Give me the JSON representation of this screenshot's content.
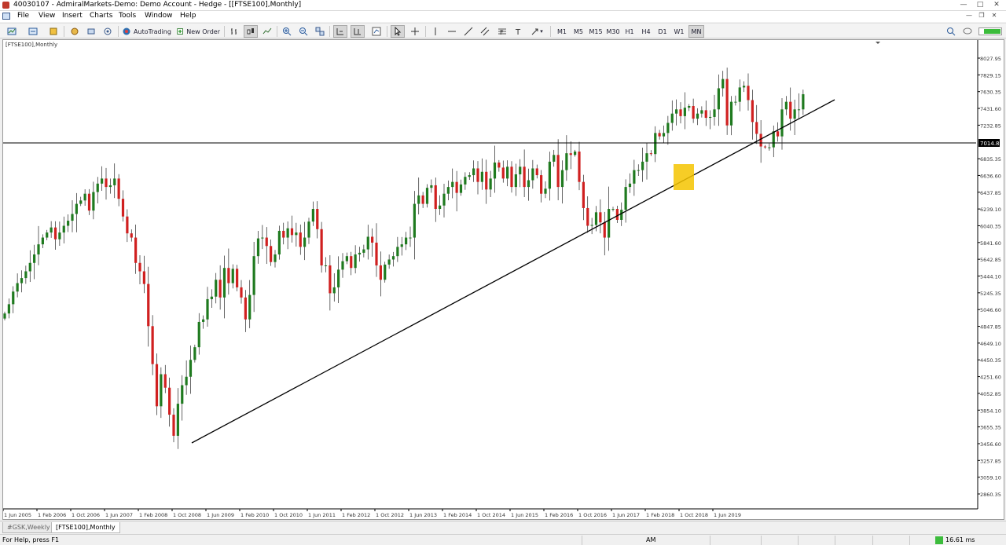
{
  "window": {
    "title": "40030107 - AdmiralMarkets-Demo: Demo Account - Hedge - [[FTSE100],Monthly]"
  },
  "menu": [
    "File",
    "View",
    "Insert",
    "Charts",
    "Tools",
    "Window",
    "Help"
  ],
  "toolbar": {
    "autotrading_label": "AutoTrading",
    "new_order_label": "New Order",
    "timeframes": [
      "M1",
      "M5",
      "M15",
      "M30",
      "H1",
      "H4",
      "D1",
      "W1",
      "MN"
    ],
    "active_timeframe": "MN"
  },
  "chart": {
    "label": "[FTSE100],Monthly",
    "price_labels": [
      "8027.95",
      "7829.15",
      "7630.35",
      "7431.60",
      "7232.85",
      "7014.81",
      "6835.35",
      "6636.60",
      "6437.85",
      "6239.10",
      "6040.35",
      "5841.60",
      "5642.85",
      "5444.10",
      "5245.35",
      "5046.60",
      "4847.85",
      "4649.10",
      "4450.35",
      "4251.60",
      "4052.85",
      "3854.10",
      "3655.35",
      "3456.60",
      "3257.85",
      "3059.10",
      "2860.35"
    ],
    "date_labels": [
      "1 Jun 2005",
      "1 Feb 2006",
      "1 Oct 2006",
      "1 Jun 2007",
      "1 Feb 2008",
      "1 Oct 2008",
      "1 Jun 2009",
      "1 Feb 2010",
      "1 Oct 2010",
      "1 Jun 2011",
      "1 Feb 2012",
      "1 Oct 2012",
      "1 Jun 2013",
      "1 Feb 2014",
      "1 Oct 2014",
      "1 Jun 2015",
      "1 Feb 2016",
      "1 Oct 2016",
      "1 Jun 2017",
      "1 Feb 2018",
      "1 Oct 2018",
      "1 Jun 2019"
    ],
    "current_price": "7014.81",
    "bull_color": "#1f7a1f",
    "bear_color": "#d02020",
    "highlight_color": "#f5c400",
    "closes": [
      5000,
      5110,
      5260,
      5360,
      5420,
      5500,
      5600,
      5700,
      5820,
      5900,
      5960,
      6020,
      5880,
      5960,
      6040,
      6100,
      6180,
      6300,
      6340,
      6420,
      6220,
      6440,
      6540,
      6600,
      6500,
      6520,
      6600,
      6360,
      6150,
      5950,
      5900,
      5600,
      5500,
      5350,
      4850,
      4400,
      3900,
      4280,
      4120,
      3800,
      3550,
      3930,
      4150,
      4250,
      4450,
      4600,
      4900,
      4930,
      5170,
      5200,
      5400,
      5190,
      5540,
      5360,
      5530,
      5310,
      5190,
      4930,
      5220,
      5680,
      5890,
      5900,
      5800,
      5610,
      5700,
      5980,
      5900,
      6010,
      5930,
      5960,
      5790,
      5900,
      6090,
      6240,
      6000,
      5570,
      5570,
      5240,
      5310,
      5520,
      5620,
      5680,
      5540,
      5700,
      5720,
      5760,
      5910,
      5840,
      5570,
      5400,
      5580,
      5640,
      5680,
      5790,
      5820,
      5900,
      5900,
      6300,
      6400,
      6300,
      6490,
      6520,
      6240,
      6280,
      6420,
      6500,
      6560,
      6430,
      6530,
      6620,
      6640,
      6720,
      6560,
      6680,
      6470,
      6600,
      6790,
      6730,
      6600,
      6740,
      6500,
      6650,
      6740,
      6500,
      6580,
      6720,
      6640,
      6420,
      6480,
      6800,
      6880,
      6500,
      6700,
      6900,
      6880,
      6920,
      6560,
      6250,
      6040,
      6050,
      6200,
      6080,
      5900,
      6240,
      6240,
      6110,
      6230,
      6500,
      6540,
      6700,
      6700,
      6800,
      6900,
      6890,
      7140,
      7100,
      7140,
      7260,
      7370,
      7420,
      7340,
      7440,
      7460,
      7310,
      7370,
      7410,
      7320,
      7330,
      7420,
      7670,
      7780,
      7230,
      7510,
      7510,
      7680,
      7700,
      7530,
      7270,
      7130,
      6980,
      6970,
      6970,
      7160,
      7100,
      7420,
      7510,
      7310,
      7420,
      7420,
      7600
    ]
  },
  "tabs": [
    {
      "label": "#GSK,Weekly",
      "active": false
    },
    {
      "label": "[FTSE100],Monthly",
      "active": true
    }
  ],
  "status": {
    "help_text": "For Help, press F1",
    "ampm": "AM",
    "ping": "16.61 ms"
  }
}
